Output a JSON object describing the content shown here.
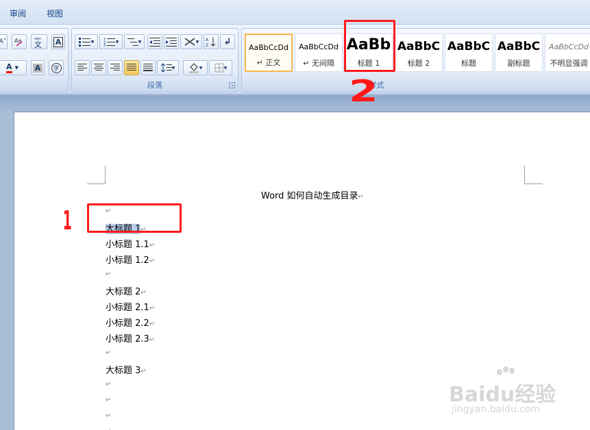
{
  "tabs": [
    {
      "label": "审阅"
    },
    {
      "label": "视图"
    }
  ],
  "ribbon": {
    "paragraph_group_label": "段落",
    "styles_group_label": "样式",
    "styles": [
      {
        "sample": "AaBbCcDd",
        "name": "↵ 正文"
      },
      {
        "sample": "AaBbCcDd",
        "name": "↵ 无间隔"
      },
      {
        "sample": "AaBb",
        "name": "标题 1"
      },
      {
        "sample": "AaBbC",
        "name": "标题 2"
      },
      {
        "sample": "AaBbC",
        "name": "标题"
      },
      {
        "sample": "AaBbC",
        "name": "副标题"
      },
      {
        "sample": "AaBbCcDd",
        "name": "不明显强调"
      }
    ]
  },
  "document": {
    "title": "Word 如何自动生成目录",
    "paragraphs": [
      {
        "text": ""
      },
      {
        "text": "大标题 1"
      },
      {
        "text": "小标题 1.1"
      },
      {
        "text": "小标题 1.2"
      },
      {
        "text": ""
      },
      {
        "text": "大标题 2"
      },
      {
        "text": "小标题 2.1"
      },
      {
        "text": "小标题 2.2"
      },
      {
        "text": "小标题 2.3"
      },
      {
        "text": ""
      },
      {
        "text": "大标题 3"
      },
      {
        "text": ""
      },
      {
        "text": ""
      },
      {
        "text": ""
      },
      {
        "text": ""
      }
    ],
    "paragraph_mark": "↵"
  },
  "annotations": {
    "step1": "1",
    "step2": "2"
  },
  "watermark": {
    "brand": "Baidu经验",
    "url": "jingyan.baidu.com"
  },
  "colors": {
    "annotation_red": "#ff1a1a",
    "selection": "#b8cbe8",
    "ribbon_text": "#15428b"
  }
}
